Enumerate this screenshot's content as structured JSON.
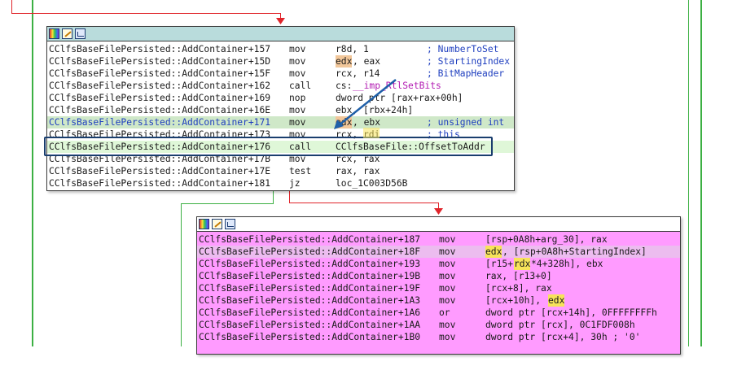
{
  "colors": {
    "edge_green": "#3cb043",
    "edge_red": "#e0242a",
    "block1_bg": "#ffffff",
    "block1_title": "#b9dcdc",
    "block2_bg": "#ff9bff",
    "block2_title": "#ffffff",
    "row_selected": "#cfe8c8",
    "row_current": "#dff7d8",
    "row_pink_hl": "#ecbcef",
    "focus_box": "#1a3e6e",
    "arrow": "#1f5fa8"
  },
  "block1": {
    "title_icons": [
      "colors-icon",
      "edit-icon",
      "graph-icon"
    ],
    "rows": [
      {
        "addr": "CClfsBaseFilePersisted::AddContainer+157",
        "mnem": "mov",
        "ops": "r8d, 1",
        "comment": "; NumberToSet"
      },
      {
        "addr": "CClfsBaseFilePersisted::AddContainer+15D",
        "mnem": "mov",
        "ops_hl": "edx",
        "ops_rest": ", eax",
        "comment": "; StartingIndex"
      },
      {
        "addr": "CClfsBaseFilePersisted::AddContainer+15F",
        "mnem": "mov",
        "ops": "rcx, r14",
        "comment": "; BitMapHeader"
      },
      {
        "addr": "CClfsBaseFilePersisted::AddContainer+162",
        "mnem": "call",
        "ops_pre": "cs:",
        "ops_fn": "__imp_RtlSetBits"
      },
      {
        "addr": "CClfsBaseFilePersisted::AddContainer+169",
        "mnem": "nop",
        "ops": "dword ptr [rax+rax+00h]"
      },
      {
        "addr": "CClfsBaseFilePersisted::AddContainer+16E",
        "mnem": "mov",
        "ops": "ebx, [rbx+24h]"
      },
      {
        "addr": "CClfsBaseFilePersisted::AddContainer+171",
        "mnem": "mov",
        "ops_hl": "edx",
        "ops_rest": ", ebx",
        "comment": "; unsigned int"
      },
      {
        "addr": "CClfsBaseFilePersisted::AddContainer+173",
        "mnem": "mov",
        "ops": "rcx, rdi",
        "comment": "; this"
      },
      {
        "addr": "CClfsBaseFilePersisted::AddContainer+176",
        "mnem": "call",
        "ops": "CClfsBaseFile::OffsetToAddr"
      },
      {
        "addr": "CClfsBaseFilePersisted::AddContainer+17B",
        "mnem": "mov",
        "ops": "rcx, rax"
      },
      {
        "addr": "CClfsBaseFilePersisted::AddContainer+17E",
        "mnem": "test",
        "ops": "rax, rax"
      },
      {
        "addr": "CClfsBaseFilePersisted::AddContainer+181",
        "mnem": "jz",
        "ops": "loc_1C003D56B"
      }
    ]
  },
  "block2": {
    "title_icons": [
      "colors-icon",
      "edit-icon",
      "graph-icon"
    ],
    "rows": [
      {
        "addr": "CClfsBaseFilePersisted::AddContainer+187",
        "mnem": "mov",
        "ops": "[rsp+0A8h+arg_30], rax"
      },
      {
        "addr": "CClfsBaseFilePersisted::AddContainer+18F",
        "mnem": "mov",
        "ops_hl": "edx",
        "ops_rest": ", [rsp+0A8h+StartingIndex]"
      },
      {
        "addr": "CClfsBaseFilePersisted::AddContainer+193",
        "mnem": "mov",
        "ops_pre": "[r15+",
        "ops_hl": "rdx",
        "ops_rest": "*4+328h], ebx"
      },
      {
        "addr": "CClfsBaseFilePersisted::AddContainer+19B",
        "mnem": "mov",
        "ops": "rax, [r13+0]"
      },
      {
        "addr": "CClfsBaseFilePersisted::AddContainer+19F",
        "mnem": "mov",
        "ops": "[rcx+8], rax"
      },
      {
        "addr": "CClfsBaseFilePersisted::AddContainer+1A3",
        "mnem": "mov",
        "ops_pre": "[rcx+10h], ",
        "ops_hl": "edx"
      },
      {
        "addr": "CClfsBaseFilePersisted::AddContainer+1A6",
        "mnem": "or",
        "ops": "dword ptr [rcx+14h], 0FFFFFFFFh"
      },
      {
        "addr": "CClfsBaseFilePersisted::AddContainer+1AA",
        "mnem": "mov",
        "ops": "dword ptr [rcx], 0C1FDF008h"
      },
      {
        "addr": "CClfsBaseFilePersisted::AddContainer+1B0",
        "mnem": "mov",
        "ops": "dword ptr [rcx+4], 30h ; '0'"
      }
    ]
  }
}
